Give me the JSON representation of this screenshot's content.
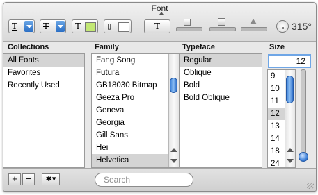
{
  "window": {
    "title": "Font"
  },
  "toolbar": {
    "underline_glyph": "T",
    "strike_glyph": "T",
    "text_color": "#c3e874",
    "doc_color": "#ffffff",
    "shadow_glyph": "T",
    "rotation": "315°"
  },
  "columns": {
    "collections": "Collections",
    "family": "Family",
    "typeface": "Typeface",
    "size": "Size"
  },
  "collections": [
    "All Fonts",
    "Favorites",
    "Recently Used"
  ],
  "families": [
    "Fang Song",
    "Futura",
    "GB18030 Bitmap",
    "Geeza Pro",
    "Geneva",
    "Georgia",
    "Gill Sans",
    "Hei",
    "Helvetica"
  ],
  "typefaces": [
    "Regular",
    "Oblique",
    "Bold",
    "Bold Oblique"
  ],
  "size": {
    "current": "12",
    "list": [
      "9",
      "10",
      "11",
      "12",
      "13",
      "14",
      "18",
      "24"
    ]
  },
  "bottom": {
    "add": "+",
    "remove": "−",
    "action": "✱▾",
    "search_placeholder": "Search"
  }
}
